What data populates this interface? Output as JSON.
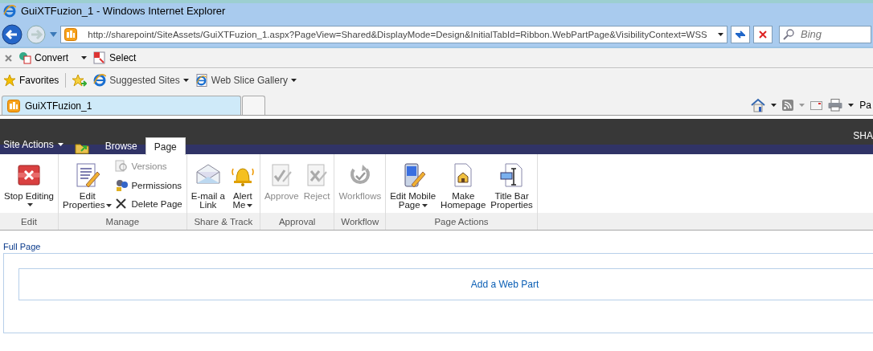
{
  "window": {
    "title": "GuiXTFuzion_1 - Windows Internet Explorer"
  },
  "address_bar": {
    "url": "http://sharepoint/SiteAssets/GuiXTFuzion_1.aspx?PageView=Shared&DisplayMode=Design&InitialTabId=Ribbon.WebPartPage&VisibilityContext=WSS",
    "search_placeholder": "Bing"
  },
  "command_bar": [
    {
      "label": "Convert",
      "menu": true
    },
    {
      "label": "Select",
      "menu": false
    }
  ],
  "favorites_bar": {
    "label": "Favorites",
    "links": [
      {
        "label": "Suggested Sites",
        "menu": true
      },
      {
        "label": "Web Slice Gallery",
        "menu": true
      }
    ]
  },
  "browser_tabs": [
    {
      "label": "GuiXTFuzion_1",
      "selected": true
    }
  ],
  "browser_toolbar": {
    "page_label": "Pa"
  },
  "sharepoint": {
    "top_bar_text": "SHA",
    "site_actions": "Site Actions",
    "ribbon_tabs": [
      {
        "label": "Browse",
        "selected": false
      },
      {
        "label": "Page",
        "selected": true
      }
    ],
    "ribbon_groups": [
      {
        "name": "Edit",
        "buttons": [
          {
            "kind": "large",
            "label": "Stop Editing",
            "menu": true,
            "disabled": false
          }
        ]
      },
      {
        "name": "Manage",
        "buttons": [
          {
            "kind": "large",
            "label": "Edit\nProperties",
            "menu": true,
            "disabled": false
          },
          {
            "kind": "small",
            "label": "Versions",
            "menu": false,
            "disabled": true
          },
          {
            "kind": "small",
            "label": "Permissions",
            "menu": false,
            "disabled": false
          },
          {
            "kind": "small",
            "label": "Delete Page",
            "menu": false,
            "disabled": false
          }
        ]
      },
      {
        "name": "Share & Track",
        "buttons": [
          {
            "kind": "large",
            "label": "E-mail a\nLink",
            "menu": false,
            "disabled": false
          },
          {
            "kind": "large",
            "label": "Alert\nMe",
            "menu": true,
            "disabled": false
          }
        ]
      },
      {
        "name": "Approval",
        "buttons": [
          {
            "kind": "large",
            "label": "Approve",
            "menu": false,
            "disabled": true
          },
          {
            "kind": "large",
            "label": "Reject",
            "menu": false,
            "disabled": true
          }
        ]
      },
      {
        "name": "Workflow",
        "buttons": [
          {
            "kind": "large",
            "label": "Workflows",
            "menu": false,
            "disabled": true
          }
        ]
      },
      {
        "name": "Page Actions",
        "buttons": [
          {
            "kind": "large",
            "label": "Edit Mobile\nPage",
            "menu": true,
            "disabled": false
          },
          {
            "kind": "large",
            "label": "Make\nHomepage",
            "menu": false,
            "disabled": false
          },
          {
            "kind": "large",
            "label": "Title Bar\nProperties",
            "menu": false,
            "disabled": false
          }
        ]
      }
    ]
  },
  "page": {
    "zone_title": "Full Page",
    "add_web_part": "Add a Web Part"
  }
}
